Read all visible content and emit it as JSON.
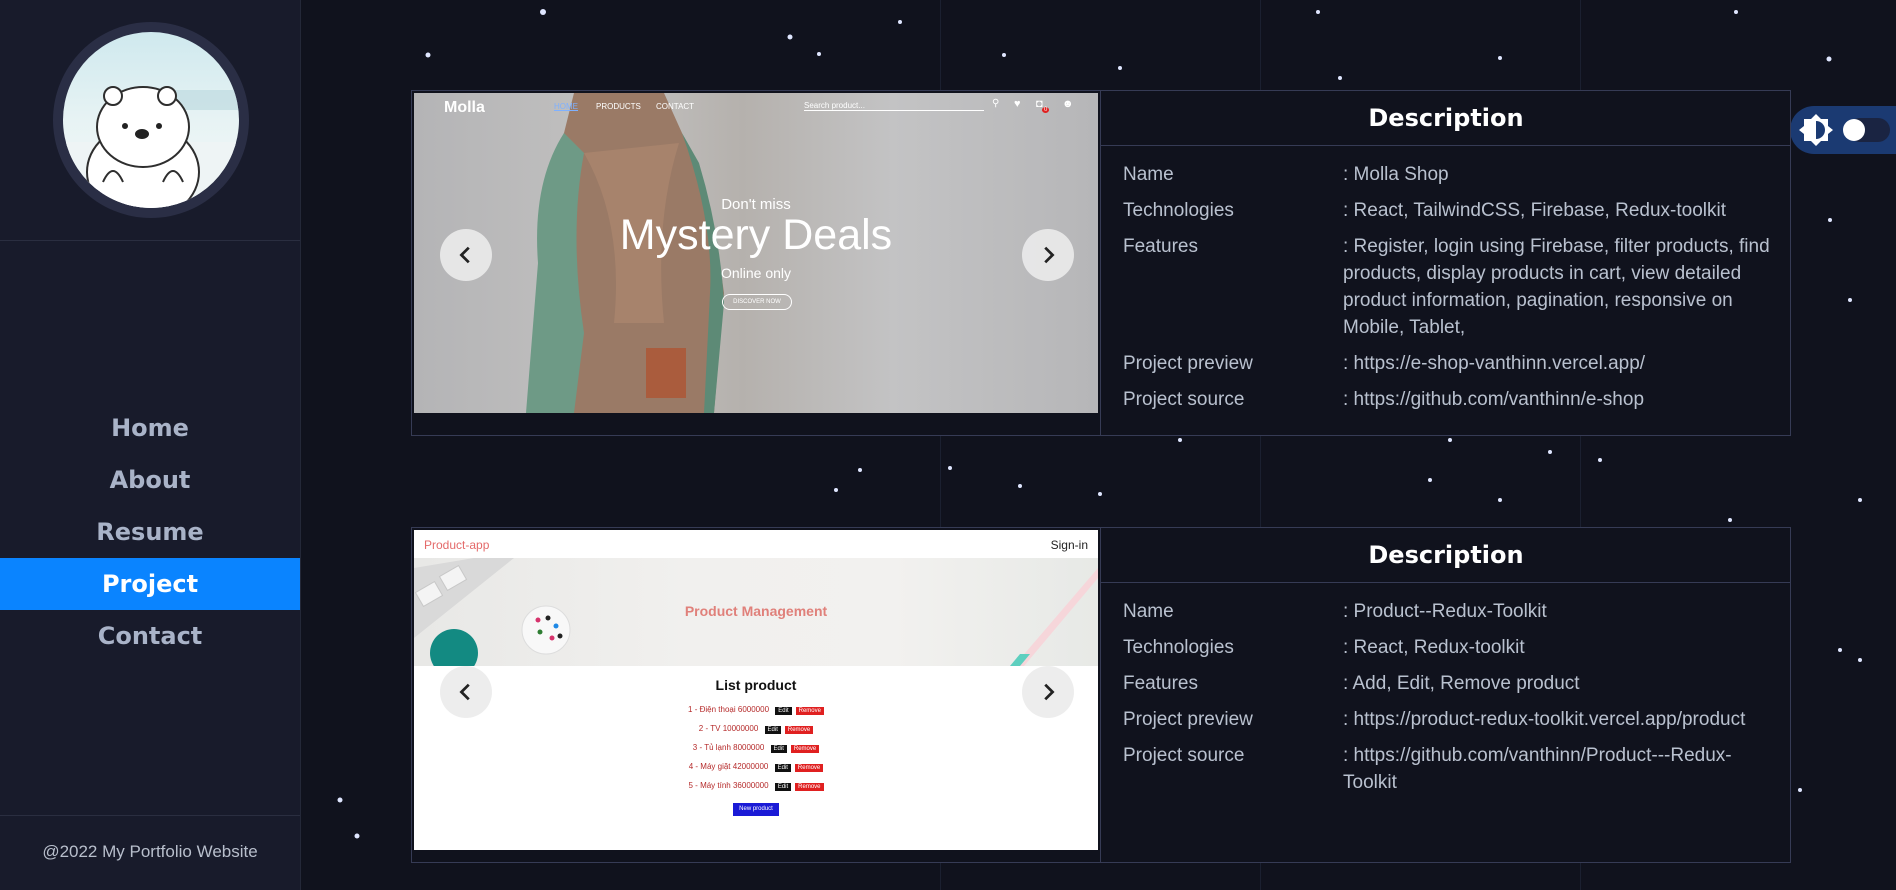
{
  "sidebar": {
    "nav": [
      {
        "label": "Home",
        "active": false
      },
      {
        "label": "About",
        "active": false
      },
      {
        "label": "Resume",
        "active": false
      },
      {
        "label": "Project",
        "active": true
      },
      {
        "label": "Contact",
        "active": false
      }
    ],
    "footer": "@2022 My Portfolio Website"
  },
  "theme_toggle": {
    "icon": "brightness-icon",
    "state": "off"
  },
  "projects": [
    {
      "preview": {
        "logo": "Molla",
        "nav_links": [
          "HOME",
          "PRODUCTS",
          "CONTACT"
        ],
        "search_placeholder": "Search product...",
        "cart_count": "0",
        "eyebrow": "Don't miss",
        "headline": "Mystery Deals",
        "sub": "Online only",
        "cta": "DISCOVER NOW"
      },
      "description": {
        "title": "Description",
        "rows": [
          {
            "key": "Name",
            "value": ": Molla Shop"
          },
          {
            "key": "Technologies",
            "value": ": React, TailwindCSS, Firebase, Redux-toolkit"
          },
          {
            "key": "Features",
            "value": ": Register, login using Firebase, filter products, find products, display products in cart, view detailed product information, pagination, responsive on Mobile, Tablet,"
          },
          {
            "key": "Project preview",
            "value": ": https://e-shop-vanthinn.vercel.app/"
          },
          {
            "key": "Project source",
            "value": ": https://github.com/vanthinn/e-shop"
          }
        ]
      }
    },
    {
      "preview": {
        "brand": "Product-app",
        "signin": "Sign-in",
        "banner_title": "Product Management",
        "list_title": "List product",
        "items": [
          {
            "no": "1",
            "name": "Điện thoại",
            "price": "6000000"
          },
          {
            "no": "2",
            "name": "TV",
            "price": "10000000"
          },
          {
            "no": "3",
            "name": "Tủ lạnh",
            "price": "8000000"
          },
          {
            "no": "4",
            "name": "Máy giặt",
            "price": "42000000"
          },
          {
            "no": "5",
            "name": "Máy tính",
            "price": "36000000"
          }
        ],
        "edit_label": "Edit",
        "remove_label": "Remove",
        "new_label": "New product"
      },
      "description": {
        "title": "Description",
        "rows": [
          {
            "key": "Name",
            "value": ": Product--Redux-Toolkit"
          },
          {
            "key": "Technologies",
            "value": ": React, Redux-toolkit"
          },
          {
            "key": "Features",
            "value": ": Add, Edit, Remove product"
          },
          {
            "key": "Project preview",
            "value": ": https://product-redux-toolkit.vercel.app/product"
          },
          {
            "key": "Project source",
            "value": ": https://github.com/vanthinn/Product---Redux-Toolkit"
          }
        ]
      }
    }
  ]
}
